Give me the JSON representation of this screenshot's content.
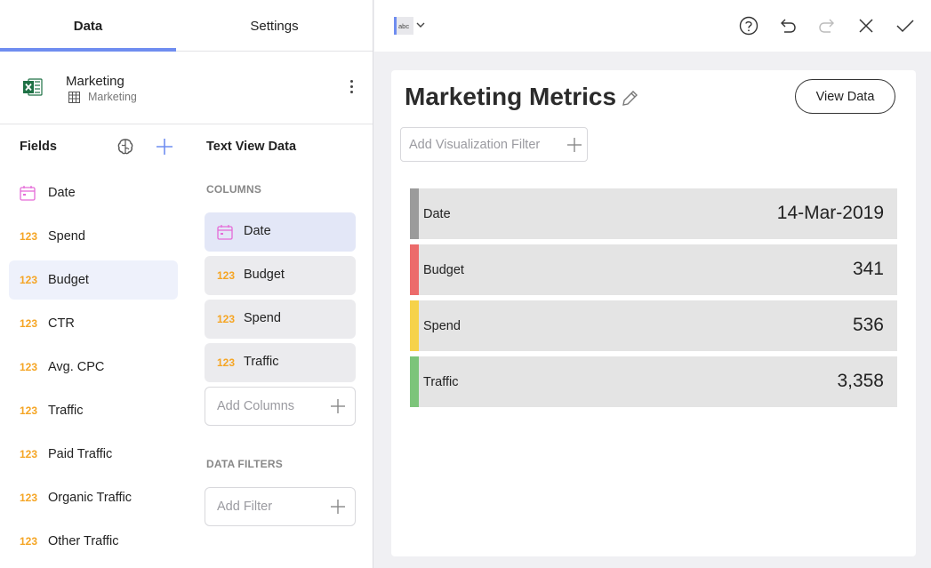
{
  "tabs": {
    "data": "Data",
    "settings": "Settings"
  },
  "source": {
    "name": "Marketing",
    "table": "Marketing"
  },
  "fields": {
    "title": "Fields",
    "items": [
      {
        "type": "date",
        "label": "Date"
      },
      {
        "type": "123",
        "label": "Spend"
      },
      {
        "type": "123",
        "label": "Budget"
      },
      {
        "type": "123",
        "label": "CTR"
      },
      {
        "type": "123",
        "label": "Avg. CPC"
      },
      {
        "type": "123",
        "label": "Traffic"
      },
      {
        "type": "123",
        "label": "Paid Traffic"
      },
      {
        "type": "123",
        "label": "Organic Traffic"
      },
      {
        "type": "123",
        "label": "Other Traffic"
      }
    ]
  },
  "text_view": {
    "title": "Text View Data",
    "columns_label": "COLUMNS",
    "columns": [
      {
        "type": "date",
        "label": "Date"
      },
      {
        "type": "123",
        "label": "Budget"
      },
      {
        "type": "123",
        "label": "Spend"
      },
      {
        "type": "123",
        "label": "Traffic"
      }
    ],
    "add_columns_placeholder": "Add Columns",
    "data_filters_label": "DATA FILTERS",
    "add_filter_placeholder": "Add Filter"
  },
  "toolbar": {
    "viz_type_icon_text": "abc"
  },
  "card": {
    "title": "Marketing Metrics",
    "view_data_label": "View Data",
    "viz_filter_placeholder": "Add Visualization Filter",
    "rows": [
      {
        "label": "Date",
        "value": "14-Mar-2019",
        "color": "#9b9b9b"
      },
      {
        "label": "Budget",
        "value": "341",
        "color": "#ec6b6b"
      },
      {
        "label": "Spend",
        "value": "536",
        "color": "#f6d24a"
      },
      {
        "label": "Traffic",
        "value": "3,358",
        "color": "#7cc47a"
      }
    ]
  },
  "colors": {
    "accent": "#6f8df0",
    "number_type": "#f5a524",
    "date_icon": "#e56bd8",
    "excel": "#1e7145"
  }
}
